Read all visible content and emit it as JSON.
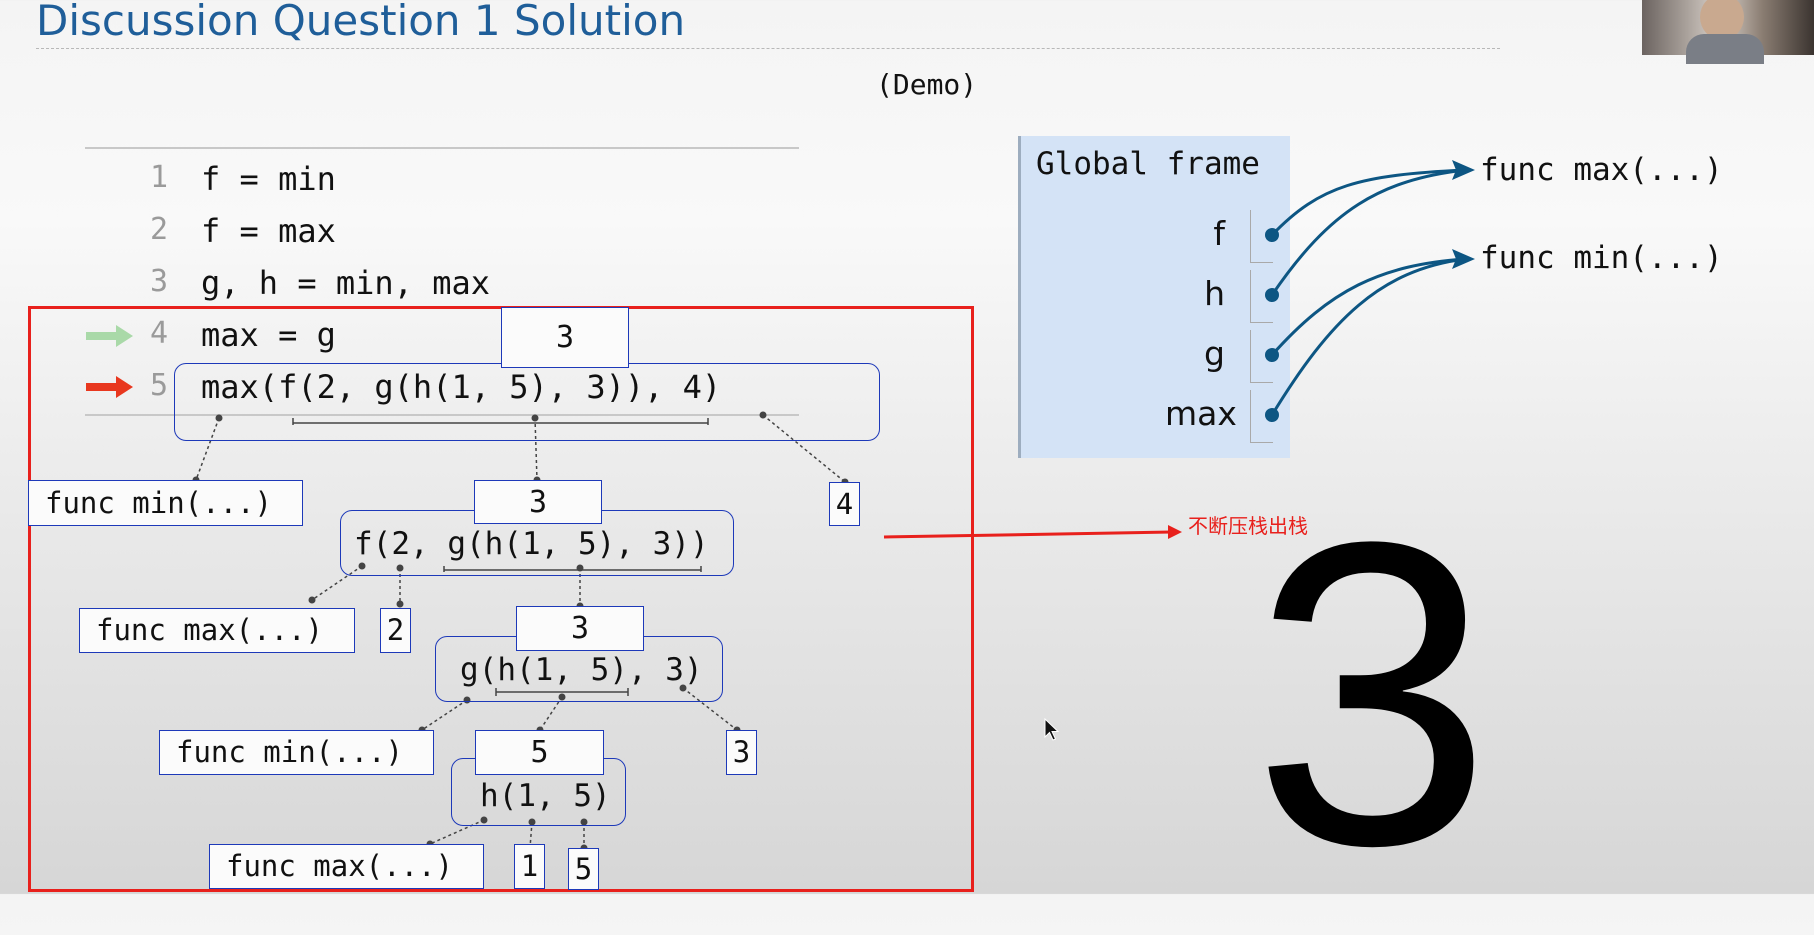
{
  "slide": {
    "title": "Discussion Question 1 Solution",
    "demo_label": "(Demo)"
  },
  "code": {
    "lines": [
      {
        "num": "1",
        "text": "f = min"
      },
      {
        "num": "2",
        "text": "f = max"
      },
      {
        "num": "3",
        "text": "g, h = min, max"
      },
      {
        "num": "4",
        "text": "max = g"
      },
      {
        "num": "5",
        "text": "max(f(2, g(h(1, 5), 3)), 4)"
      }
    ],
    "arrows": {
      "last_executed_color": "#a9d9a8",
      "next_line_color": "#e8371e"
    }
  },
  "eval_tree": {
    "root_value": "3",
    "root_expr": "max(f(2, g(h(1, 5), 3)), 4)",
    "root_func": "func min(...)",
    "root_arg2": "4",
    "f_value": "3",
    "f_expr": "f(2, g(h(1, 5), 3))",
    "f_func": "func max(...)",
    "f_arg1": "2",
    "g_value": "3",
    "g_expr": "g(h(1, 5), 3)",
    "g_func": "func min(...)",
    "g_arg2": "3",
    "h_value": "5",
    "h_expr": "h(1, 5)",
    "h_func": "func max(...)",
    "h_arg1": "1",
    "h_arg2": "5"
  },
  "global_frame": {
    "title": "Global frame",
    "variables": [
      "f",
      "h",
      "g",
      "max"
    ],
    "objects": [
      "func max(...)",
      "func min(...)"
    ]
  },
  "annotation": "不断压栈出栈",
  "big_result": "3",
  "colors": {
    "title": "#1f5e99",
    "box_border": "#1d39b9",
    "red_frame": "#e8201c",
    "frame_bg": "#d4e3f6",
    "pointer": "#0d5683"
  }
}
